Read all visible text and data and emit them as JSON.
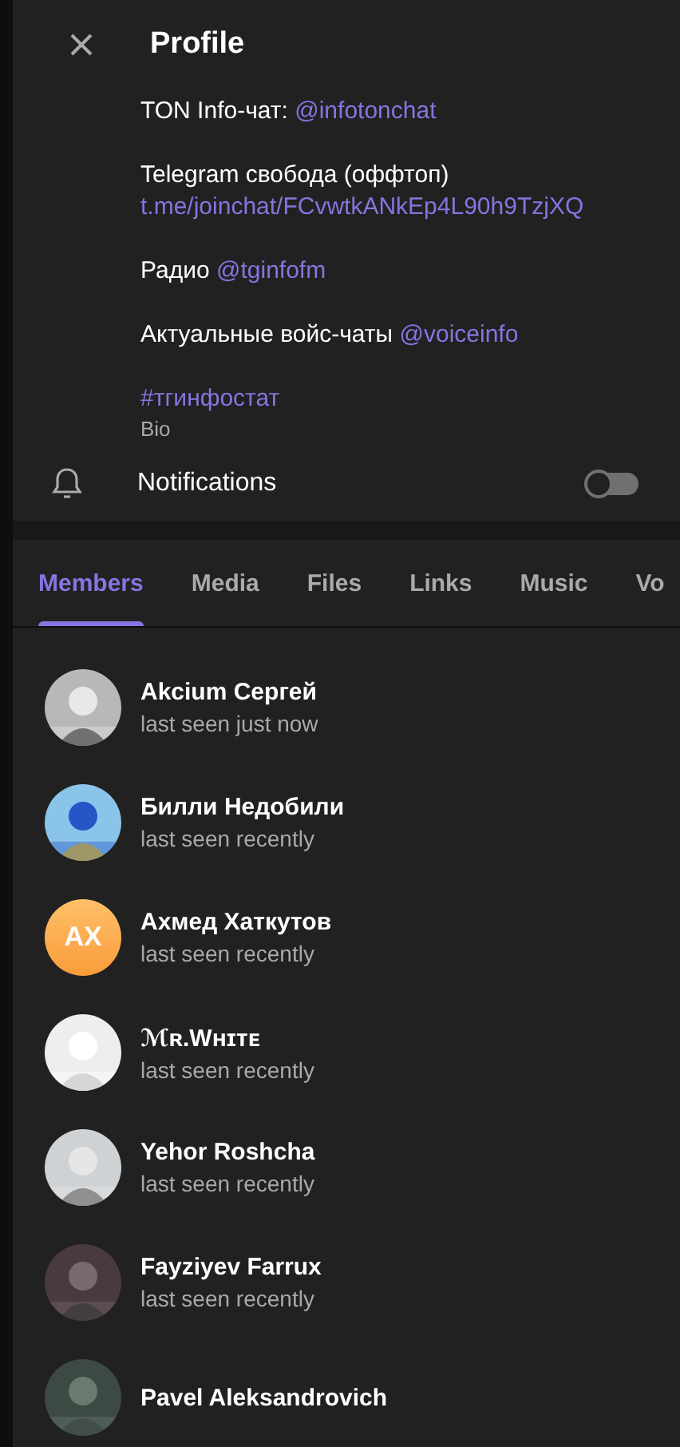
{
  "header": {
    "title": "Profile"
  },
  "bio_lines": [
    {
      "label": "TON Info-чат:",
      "link": "@infotonchat"
    },
    {
      "label": "Telegram свобода (оффтоп)",
      "link": "t.me/joinchat/FCvwtkANkEp4L90h9TzjXQ"
    },
    {
      "label": "Радио",
      "link": "@tginfofm"
    },
    {
      "label": "Актуальные войс-чаты",
      "link": "@voiceinfo"
    },
    {
      "link": "#тгинфостат"
    }
  ],
  "bio_caption": "Bio",
  "notifications": {
    "label": "Notifications",
    "on": false
  },
  "tabs": [
    {
      "label": "Members",
      "selected": true
    },
    {
      "label": "Media",
      "selected": false
    },
    {
      "label": "Files",
      "selected": false
    },
    {
      "label": "Links",
      "selected": false
    },
    {
      "label": "Music",
      "selected": false
    },
    {
      "label": "Vo",
      "selected": false
    }
  ],
  "members": [
    {
      "name": "Akcium Сергей",
      "status": "last seen just now"
    },
    {
      "name": "Билли Недобили",
      "status": "last seen recently"
    },
    {
      "name": "Ахмед Хаткутов",
      "status": "last seen recently",
      "avatar": {
        "kind": "initials",
        "initials": "AX"
      }
    },
    {
      "name": "ℳʀ.Wʜɪᴛᴇ",
      "status": "last seen recently"
    },
    {
      "name": "Yehor Roshcha",
      "status": "last seen recently"
    },
    {
      "name": "Fayziyev Farrux",
      "status": "last seen recently"
    },
    {
      "name": "Pavel Aleksandrovich"
    }
  ]
}
